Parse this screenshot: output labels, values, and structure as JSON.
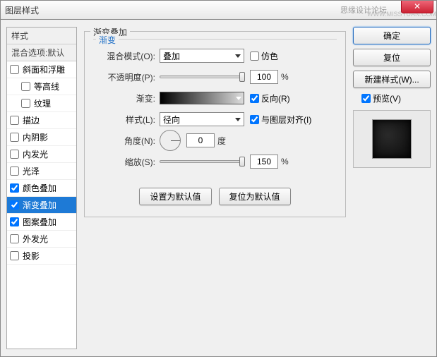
{
  "titlebar": {
    "title": "图层样式",
    "watermark": "思缘设计论坛",
    "watermark2": "WWW.MISSYUAN.COM",
    "close": "✕"
  },
  "left": {
    "header": "样式",
    "sub": "混合选项:默认",
    "items": [
      {
        "label": "斜面和浮雕",
        "checked": false,
        "indent": false
      },
      {
        "label": "等高线",
        "checked": false,
        "indent": true
      },
      {
        "label": "纹理",
        "checked": false,
        "indent": true
      },
      {
        "label": "描边",
        "checked": false,
        "indent": false
      },
      {
        "label": "内阴影",
        "checked": false,
        "indent": false
      },
      {
        "label": "内发光",
        "checked": false,
        "indent": false
      },
      {
        "label": "光泽",
        "checked": false,
        "indent": false
      },
      {
        "label": "颜色叠加",
        "checked": true,
        "indent": false
      },
      {
        "label": "渐变叠加",
        "checked": true,
        "indent": false,
        "selected": true
      },
      {
        "label": "图案叠加",
        "checked": true,
        "indent": false
      },
      {
        "label": "外发光",
        "checked": false,
        "indent": false
      },
      {
        "label": "投影",
        "checked": false,
        "indent": false
      }
    ]
  },
  "center": {
    "group_title": "渐变叠加",
    "sub_title": "渐变",
    "blend_label": "混合模式(O):",
    "blend_value": "叠加",
    "dither_label": "仿色",
    "opacity_label": "不透明度(P):",
    "opacity_value": "100",
    "pct": "%",
    "gradient_label": "渐变:",
    "reverse_label": "反向(R)",
    "style_label": "样式(L):",
    "style_value": "径向",
    "align_label": "与图层对齐(I)",
    "angle_label": "角度(N):",
    "angle_value": "0",
    "deg": "度",
    "scale_label": "缩放(S):",
    "scale_value": "150",
    "btn_default": "设置为默认值",
    "btn_reset": "复位为默认值"
  },
  "right": {
    "ok": "确定",
    "cancel": "复位",
    "newstyle": "新建样式(W)...",
    "preview_label": "预览(V)"
  }
}
